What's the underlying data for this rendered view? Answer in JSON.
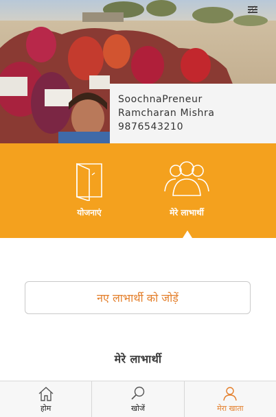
{
  "profile": {
    "role": "SoochnaPreneur",
    "name": "Ramcharan Mishra",
    "phone": "9876543210"
  },
  "tabs": [
    {
      "label": "योजनाएं",
      "icon": "folder-icon"
    },
    {
      "label": "मेरे लाभार्थी",
      "icon": "users-group-icon"
    }
  ],
  "active_tab": "मेरे लाभार्थी",
  "add_beneficiary_label": "नए लाभार्थी को जोड़ें",
  "section_title": "मेरे लाभार्थी",
  "bottom_nav": [
    {
      "label": "होम",
      "icon": "home-icon"
    },
    {
      "label": "खोजें",
      "icon": "search-icon"
    },
    {
      "label": "मेरा खाता",
      "icon": "user-icon"
    }
  ],
  "active_nav": "मेरा खाता",
  "colors": {
    "accent_orange": "#f4a11e",
    "active_text": "#e37d28",
    "profile_card_bg": "#f4f4f4"
  }
}
